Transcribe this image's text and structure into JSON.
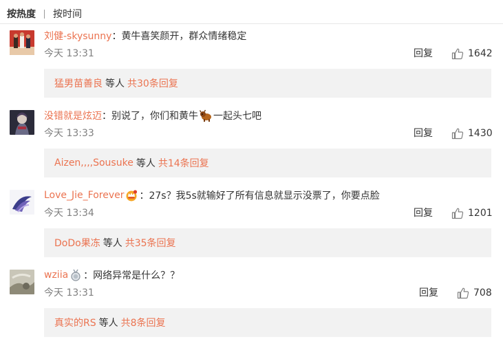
{
  "sort": {
    "hot_label": "按热度",
    "time_label": "按时间"
  },
  "comments": [
    {
      "user": "刘健-skysunny",
      "sep": "：",
      "text": "黄牛喜笑颜开，群众情绪稳定",
      "time": "今天 13:31",
      "reply_label": "回复",
      "likes": "1642",
      "sub": {
        "user": "猛男苗善良",
        "etc": "等人",
        "total": "共30条回复"
      }
    },
    {
      "user": "没错就是炫迈",
      "sep": "：",
      "text_before": "别说了，你们和黄牛",
      "emoji": "ox-emoji",
      "text_after": "一起头七吧",
      "time": "今天 13:33",
      "reply_label": "回复",
      "likes": "1430",
      "sub": {
        "user": "Aizen,,,,Sousuke",
        "etc": "等人",
        "total": "共14条回复"
      }
    },
    {
      "user": "Love_Jie_Forever",
      "badge": "vip-crown-badge",
      "sep": "：",
      "text": "27s？我5s就输好了所有信息就显示没票了，你要点脸",
      "time": "今天 13:34",
      "reply_label": "回复",
      "likes": "1201",
      "sub": {
        "user": "DoDo果冻",
        "etc": "等人",
        "total": "共35条回复"
      }
    },
    {
      "user": "wziia",
      "badge": "medal-badge",
      "sep": "：",
      "text": "网络异常是什么？？",
      "time": "今天 13:31",
      "reply_label": "回复",
      "likes": "708",
      "sub": {
        "user": "真实的RS",
        "etc": "等人",
        "total": "共8条回复"
      }
    }
  ],
  "colors": {
    "username": "#eb7350",
    "text": "#333333",
    "time": "#808080",
    "subbox_bg": "#f2f2f2"
  }
}
